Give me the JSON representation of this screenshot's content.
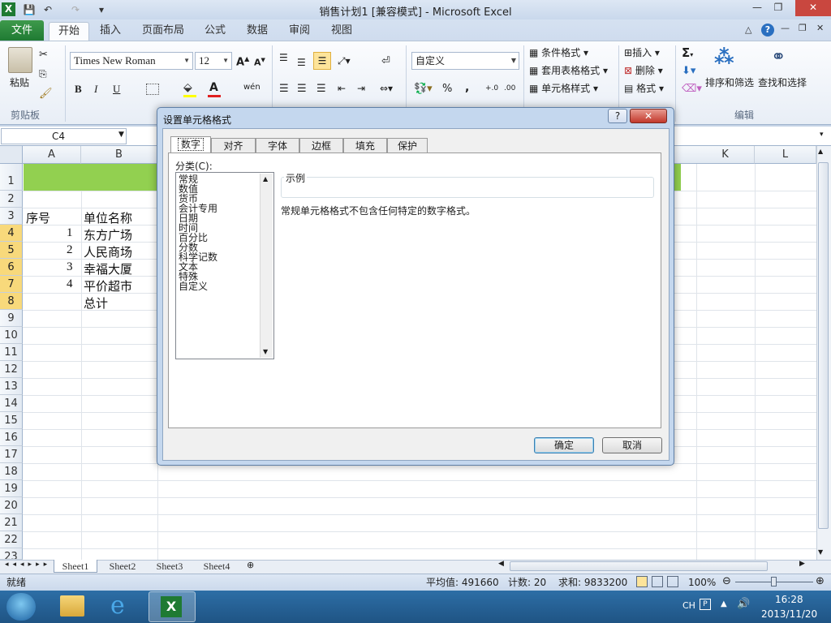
{
  "window": {
    "title": "销售计划1  [兼容模式] - Microsoft Excel",
    "minimize_icon": "minimize-icon",
    "restore_icon": "restore-icon",
    "close_icon": "close-icon"
  },
  "ribbon_tabs": [
    "文件",
    "开始",
    "插入",
    "页面布局",
    "公式",
    "数据",
    "审阅",
    "视图"
  ],
  "active_tab": "开始",
  "ribbon": {
    "clipboard": {
      "paste_label": "粘贴",
      "group_label": "剪贴板"
    },
    "font": {
      "name": "Times New Roman",
      "size": "12",
      "bold": "B",
      "italic": "I",
      "underline": "U",
      "wen": "wén"
    },
    "number": {
      "format": "自定义",
      "percent": "%",
      "comma": ","
    },
    "styles": {
      "conditional": "条件格式",
      "table": "套用表格格式",
      "cell": "单元格样式"
    },
    "cells": {
      "insert": "插入",
      "delete": "删除",
      "format": "格式"
    },
    "editing": {
      "sigma": "Σ",
      "sort_filter": "排序和筛选",
      "find_select": "查找和选择",
      "group_label": "编辑"
    }
  },
  "formula_bar": {
    "name_box": "C4"
  },
  "columns": [
    "A",
    "B",
    "K",
    "L"
  ],
  "rows": [
    "1",
    "2",
    "3",
    "4",
    "5",
    "6",
    "7",
    "8",
    "9",
    "10",
    "11",
    "12",
    "13",
    "14",
    "15",
    "16",
    "17",
    "18",
    "19",
    "20",
    "21",
    "22",
    "23"
  ],
  "cells": {
    "a3": "序号",
    "b3": "单位名称",
    "a4": "1",
    "b4": "东方广场",
    "a5": "2",
    "b5": "人民商场",
    "a6": "3",
    "b6": "幸福大厦",
    "a7": "4",
    "b7": "平价超市",
    "b8": "总计"
  },
  "sheets": [
    "Sheet1",
    "Sheet2",
    "Sheet3",
    "Sheet4"
  ],
  "status": {
    "mode": "就绪",
    "average": "平均值: 491660",
    "count": "计数: 20",
    "sum": "求和: 9833200",
    "zoom": "100%"
  },
  "dialog": {
    "title": "设置单元格格式",
    "help": "?",
    "tabs": [
      "数字",
      "对齐",
      "字体",
      "边框",
      "填充",
      "保护"
    ],
    "category_label": "分类(C):",
    "categories": [
      "常规",
      "数值",
      "货币",
      "会计专用",
      "日期",
      "时间",
      "百分比",
      "分数",
      "科学记数",
      "文本",
      "特殊",
      "自定义"
    ],
    "sample_label": "示例",
    "description": "常规单元格格式不包含任何特定的数字格式。",
    "ok": "确定",
    "cancel": "取消"
  },
  "taskbar": {
    "lang": "CH",
    "time": "16:28",
    "date": "2013/11/20"
  },
  "colors": {
    "header_fill": "#92d050",
    "selected_row": "#f8d97b",
    "file_tab": "#1f7a33"
  }
}
